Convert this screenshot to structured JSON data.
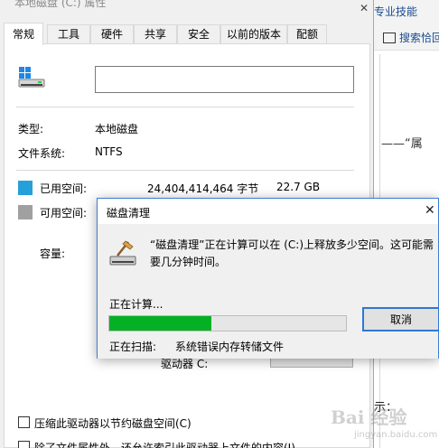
{
  "background": {
    "link_help": "专业技能",
    "link_search": "搜索恰回",
    "quote": "——“属",
    "show_label": "示：",
    "watermark": "Bai 经验",
    "watermark_sub": "jingyan.baidu.com",
    "close_glyph": "✕"
  },
  "properties": {
    "title": "本地磁盘 (C:) 属性",
    "tabs": [
      "常规",
      "工具",
      "硬件",
      "共享",
      "安全",
      "以前的版本",
      "配额"
    ],
    "active_tab": "常规",
    "name_value": "",
    "type_label": "类型:",
    "type_value": "本地磁盘",
    "fs_label": "文件系统:",
    "fs_value": "NTFS",
    "used_label": "已用空间:",
    "used_bytes": "24,404,414,464 字节",
    "used_gb": "22.7 GB",
    "free_label": "可用空间:",
    "capacity_label": "容量:",
    "drive_label": "驱动器 C:",
    "compress_label": "压缩此驱动器以节约磁盘空间(C)",
    "index_label": "除了文件属性外，还允许索引此驱动器上文件的内容(I)"
  },
  "dialog": {
    "title": "磁盘清理",
    "close_glyph": "✕",
    "message": "“磁盘清理”正在计算可以在 (C:)上释放多少空间。这可能需要几分钟时间。",
    "calculating": "正在计算...",
    "progress": 0.43,
    "cancel_label": "取消",
    "scanning_label": "正在扫描:",
    "scanning_value": "系统错误内存转储文件"
  },
  "colors": {
    "used": "#26a0da",
    "free": "#a0a0a0",
    "progress": "#06b025",
    "accent": "#2f78d2"
  }
}
